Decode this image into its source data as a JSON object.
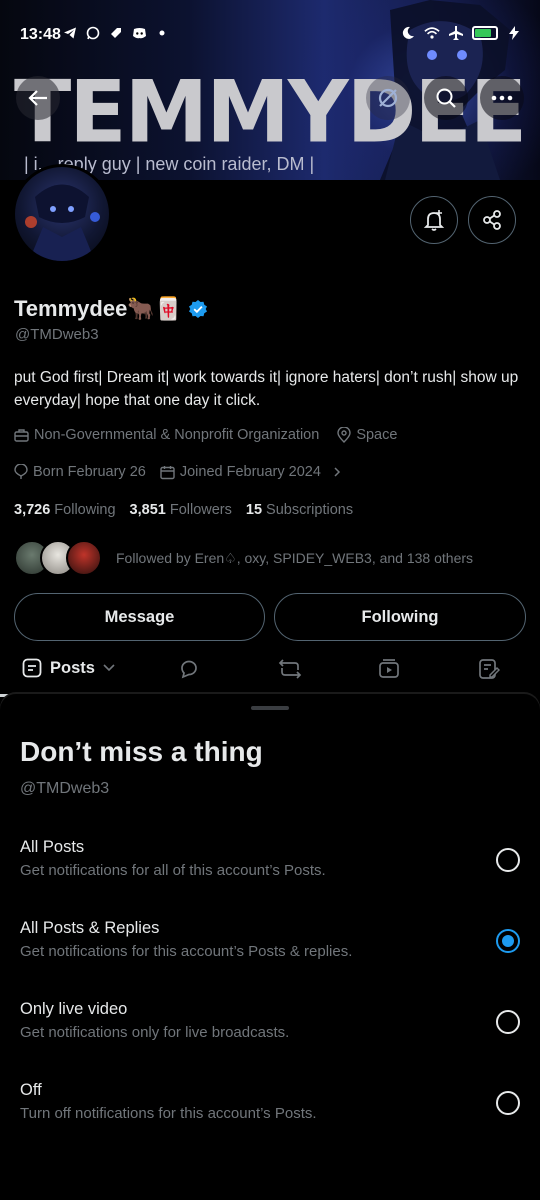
{
  "status_bar": {
    "time": "13:48",
    "battery_level": 0.8,
    "battery_color": "#35c759"
  },
  "banner": {
    "title": "TEMMYDEE",
    "tagline": "| i... reply guy | new coin raider, DM |"
  },
  "nav": {
    "back_icon": "arrow-left-icon",
    "premium_icon": "premium-slash-icon",
    "search_icon": "search-icon",
    "more_icon": "more-icon"
  },
  "profile": {
    "display_name": "Temmydee🐂🀄",
    "handle": "@TMDweb3",
    "bio": "put God first| Dream it| work towards it| ignore haters| don’t rush| show up everyday| hope that one day it click.",
    "category": "Non-Governmental & Nonprofit Organization",
    "location": "Space",
    "born": "Born February 26",
    "joined": "Joined February 2024",
    "following_count": "3,726",
    "following_label": "Following",
    "followers_count": "3,851",
    "followers_label": "Followers",
    "subscriptions_count": "15",
    "subscriptions_label": "Subscriptions",
    "followed_by": "Followed by Eren♤, oxy, SPIDEY_WEB3, and 138 others",
    "verified_color": "#1d9bf0"
  },
  "actions": {
    "message": "Message",
    "following": "Following"
  },
  "tabs": {
    "posts": "Posts"
  },
  "sheet": {
    "title": "Don’t miss a thing",
    "subtitle": "@TMDweb3",
    "options": [
      {
        "title": "All Posts",
        "desc": "Get notifications for all of this account’s Posts.",
        "selected": false
      },
      {
        "title": "All Posts & Replies",
        "desc": "Get notifications for this account’s Posts & replies.",
        "selected": true
      },
      {
        "title": "Only live video",
        "desc": "Get notifications only for live broadcasts.",
        "selected": false
      },
      {
        "title": "Off",
        "desc": "Turn off notifications for this account’s Posts.",
        "selected": false
      }
    ]
  }
}
